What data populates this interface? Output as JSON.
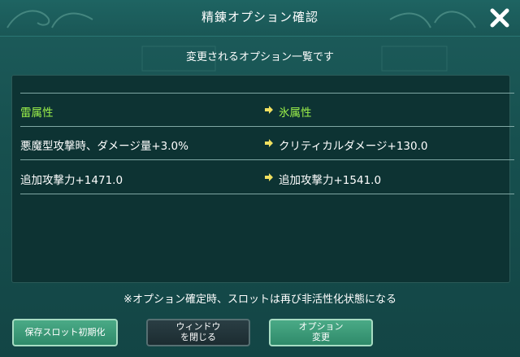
{
  "dialog": {
    "title": "精錬オプション確認",
    "subtitle": "変更されるオプション一覧です",
    "close_icon": "close-icon"
  },
  "options": [
    {
      "before": "雷属性",
      "after": "氷属性",
      "highlight": true
    },
    {
      "before": "悪魔型攻撃時、ダメージ量+3.0%",
      "after": "クリティカルダメージ+130.0",
      "highlight": false
    },
    {
      "before": "追加攻撃力+1471.0",
      "after": "追加攻撃力+1541.0",
      "highlight": false
    }
  ],
  "note": "※オプション確定時、スロットは再び非活性化状態になる",
  "buttons": {
    "reset_slot": "保存スロット初期化",
    "close_window_line1": "ウィンドウ",
    "close_window_line2": "を閉じる",
    "change_option_line1": "オプション",
    "change_option_line2": "変更"
  },
  "colors": {
    "highlight_text": "#9cf04a",
    "arrow": "#f0e060",
    "panel_bg": "#0d3333"
  }
}
